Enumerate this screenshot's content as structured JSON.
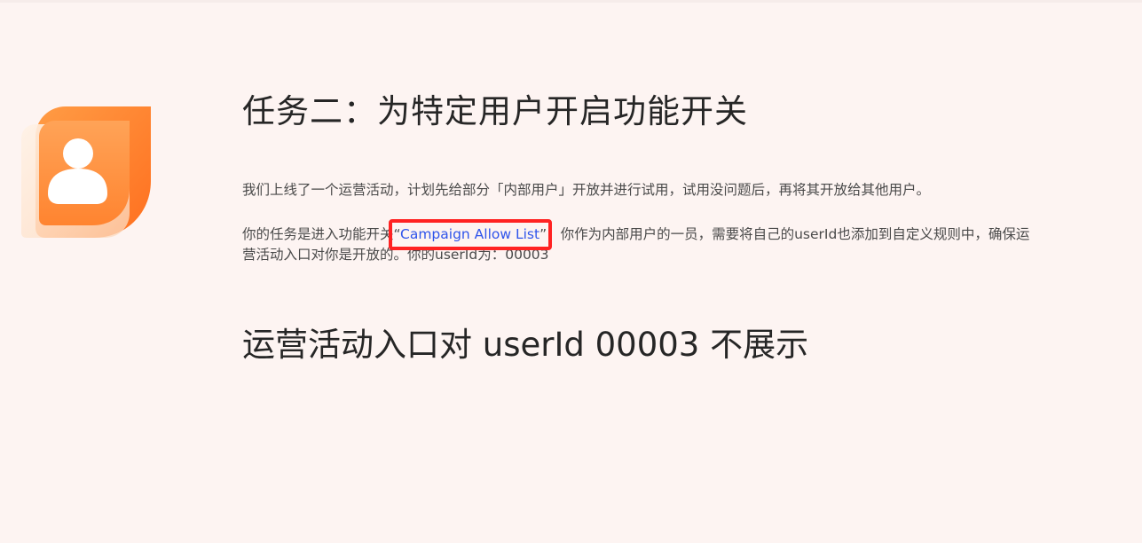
{
  "task": {
    "title": "任务二：为特定用户开启功能开关",
    "intro": "我们上线了一个运营活动，计划先给部分「内部用户」开放并进行试用，试用没问题后，再将其开放给其他用户。",
    "instruction_before": "你的任务是进入功能开关",
    "open_quote": "“",
    "link_label": "Campaign Allow List",
    "close_quote": "”",
    "instruction_after": "，你作为内部用户的一员，需要将自己的userId也添加到自定义规则中，确保运营活动入口对你是开放的。你的userId为：00003"
  },
  "status": {
    "message": "运营活动入口对 userId 00003 不展示"
  },
  "logo": {
    "icon": "user-avatar-icon",
    "colors": {
      "back_leaf": "#ff8a3d",
      "front_leaf": "#ff9a4d",
      "glass": "#fde3cf",
      "figure": "#ffffff"
    }
  },
  "colors": {
    "background": "#fdf4f2",
    "link": "#2f54eb",
    "highlight_border": "#ff2222",
    "title_text": "#262626",
    "body_text": "#4a4a4a"
  }
}
